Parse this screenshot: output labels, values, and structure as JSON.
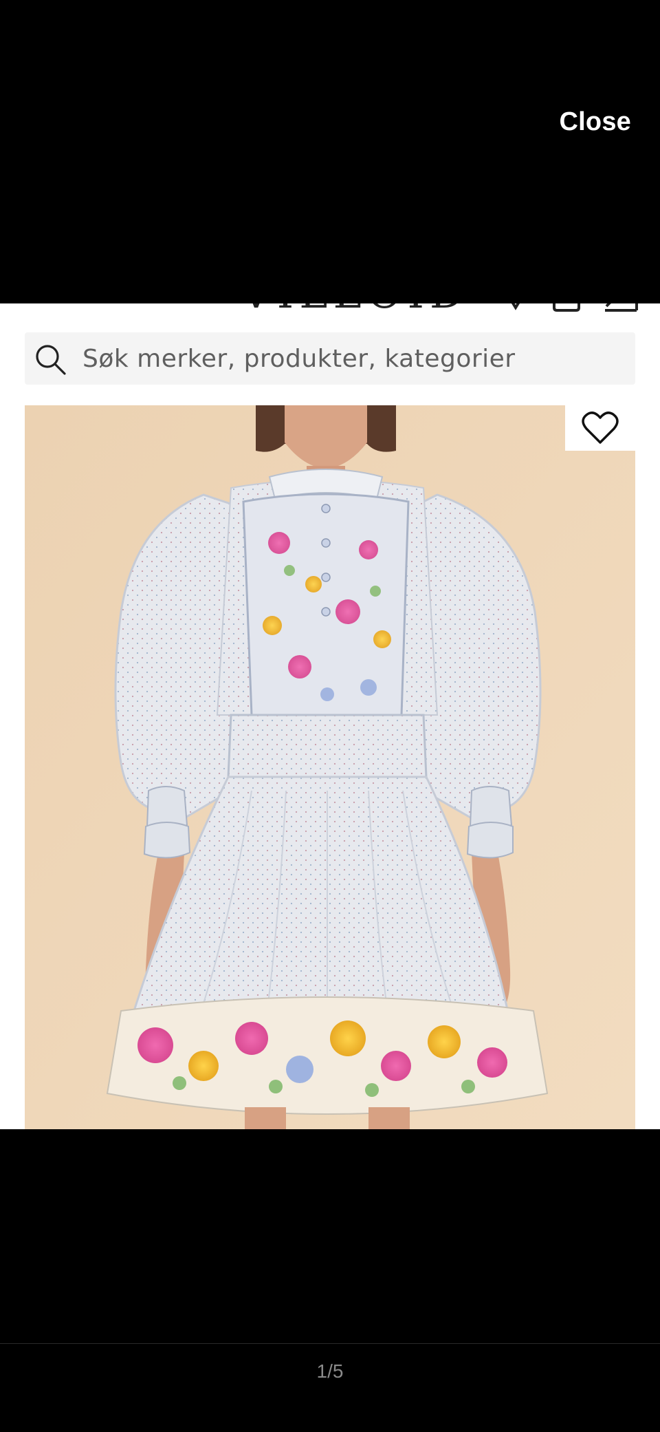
{
  "viewer": {
    "close_label": "Close",
    "pager_text": "1/5"
  },
  "site": {
    "logo_fragment": "VILLOID"
  },
  "search": {
    "placeholder": "Søk merker, produkter, kategorier",
    "value": ""
  },
  "product": {
    "favorite_icon": "heart-outline-icon",
    "image_subject": "dress"
  },
  "colors": {
    "background": "#000000",
    "accent_text": "#ffffff",
    "search_bg": "#f4f4f4",
    "photo_backdrop": "#f0d6b4"
  }
}
